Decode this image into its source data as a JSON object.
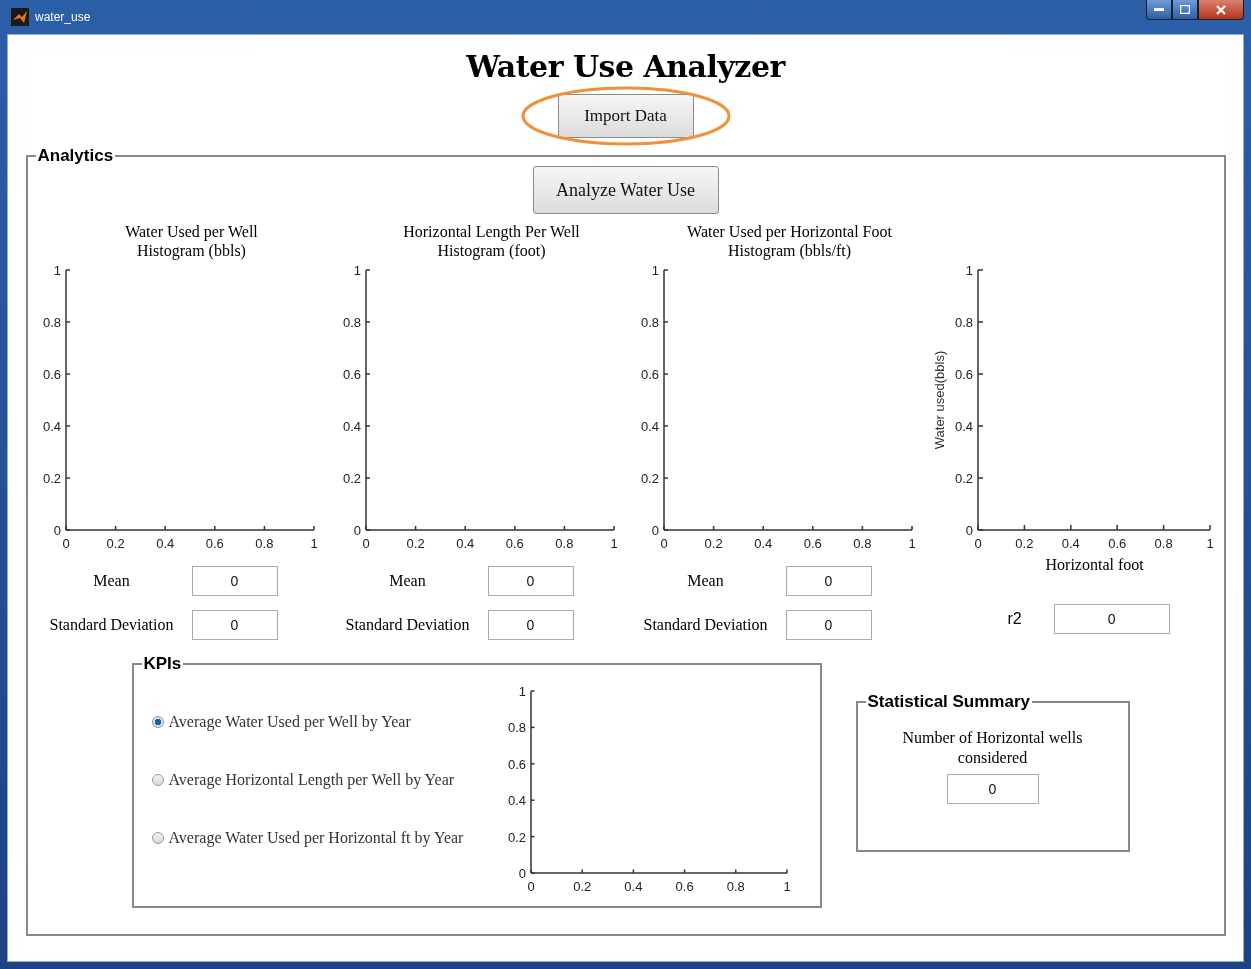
{
  "window": {
    "title": "water_use"
  },
  "heading": "Water Use Analyzer",
  "import_button": {
    "label": "Import Data",
    "circled": true
  },
  "analytics": {
    "title": "Analytics",
    "analyze_button": "Analyze Water Use",
    "plots": [
      {
        "kind": "histogram",
        "chart_data": {
          "type": "histogram",
          "title": "Water Used per Well\nHistogram (bbls)",
          "xlim": [
            0,
            1
          ],
          "ylim": [
            0,
            1
          ],
          "xticks": [
            0,
            0.2,
            0.4,
            0.6,
            0.8,
            1
          ],
          "yticks": [
            0,
            0.2,
            0.4,
            0.6,
            0.8,
            1
          ]
        },
        "stats": [
          {
            "label": "Mean",
            "value": "0"
          },
          {
            "label": "Standard Deviation",
            "value": "0"
          }
        ]
      },
      {
        "kind": "histogram",
        "chart_data": {
          "type": "histogram",
          "title": "Horizontal Length Per Well\nHistogram (foot)",
          "xlim": [
            0,
            1
          ],
          "ylim": [
            0,
            1
          ],
          "xticks": [
            0,
            0.2,
            0.4,
            0.6,
            0.8,
            1
          ],
          "yticks": [
            0,
            0.2,
            0.4,
            0.6,
            0.8,
            1
          ]
        },
        "stats": [
          {
            "label": "Mean",
            "value": "0"
          },
          {
            "label": "Standard Deviation",
            "value": "0"
          }
        ]
      },
      {
        "kind": "histogram",
        "chart_data": {
          "type": "histogram",
          "title": "Water Used per Horizontal Foot\nHistogram (bbls/ft)",
          "xlim": [
            0,
            1
          ],
          "ylim": [
            0,
            1
          ],
          "xticks": [
            0,
            0.2,
            0.4,
            0.6,
            0.8,
            1
          ],
          "yticks": [
            0,
            0.2,
            0.4,
            0.6,
            0.8,
            1
          ]
        },
        "stats": [
          {
            "label": "Mean",
            "value": "0"
          },
          {
            "label": "Standard Deviation",
            "value": "0"
          }
        ]
      },
      {
        "kind": "regression",
        "chart_data": {
          "type": "scatter",
          "xlabel": "Horizontal foot",
          "ylabel": "Water used(bbls)",
          "xlim": [
            0,
            1
          ],
          "ylim": [
            0,
            1
          ],
          "xticks": [
            0,
            0.2,
            0.4,
            0.6,
            0.8,
            1
          ],
          "yticks": [
            0,
            0.2,
            0.4,
            0.6,
            0.8,
            1
          ]
        },
        "stats": [
          {
            "label": "r2",
            "value": "0"
          }
        ]
      }
    ]
  },
  "kpis": {
    "title": "KPIs",
    "options": [
      {
        "label": "Average Water Used per Well by Year",
        "selected": true
      },
      {
        "label": "Average Horizontal Length per Well by Year",
        "selected": false
      },
      {
        "label": "Average Water Used per Horizontal ft by Year",
        "selected": false
      }
    ],
    "chart_data": {
      "type": "line",
      "xlim": [
        0,
        1
      ],
      "ylim": [
        0,
        1
      ],
      "xticks": [
        0,
        0.2,
        0.4,
        0.6,
        0.8,
        1
      ],
      "yticks": [
        0,
        0.2,
        0.4,
        0.6,
        0.8,
        1
      ]
    }
  },
  "summary": {
    "title": "Statistical Summary",
    "label": "Number of Horizontal wells considered",
    "value": "0"
  }
}
